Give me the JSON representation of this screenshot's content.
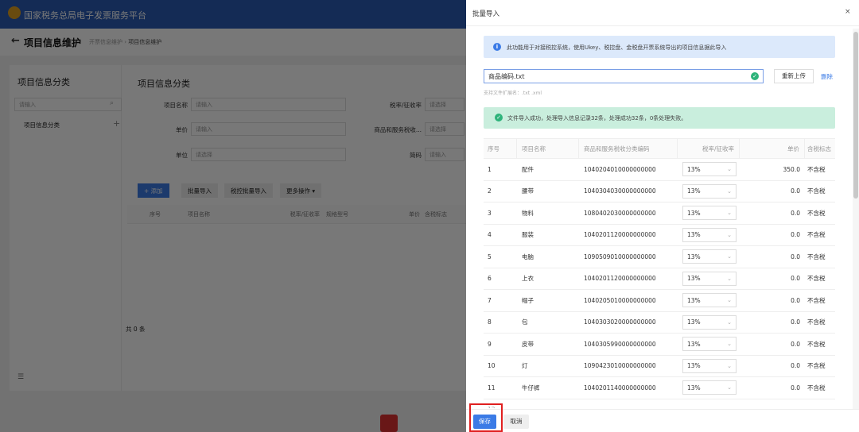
{
  "app": {
    "title": "国家税务总局电子发票服务平台"
  },
  "page": {
    "title": "项目信息维护",
    "breadcrumb": [
      "开票信息维护",
      "项目信息维护"
    ],
    "back_icon": "arrow-left-icon"
  },
  "sidebar": {
    "title": "项目信息分类",
    "search_placeholder": "请输入",
    "tree_item": "项目信息分类"
  },
  "main": {
    "title": "项目信息分类",
    "filters": [
      {
        "label": "项目名称",
        "placeholder": "请输入"
      },
      {
        "label": "税率/征收率",
        "placeholder": "请选择"
      },
      {
        "label": "单价",
        "placeholder": "请输入"
      },
      {
        "label": "商品和服务税收...",
        "placeholder": "请选择"
      },
      {
        "label": "单位",
        "placeholder": "请选择"
      },
      {
        "label": "简码",
        "placeholder": "请输入"
      }
    ],
    "buttons": {
      "add": "+ 添加",
      "batch_import": "批量导入",
      "taxctrl_import": "税控批量导入",
      "more": "更多操作 ▾"
    },
    "columns": [
      "序号",
      "项目名称",
      "税率/征收率",
      "规格型号",
      "单价",
      "含税标志"
    ],
    "total": "共 0 条"
  },
  "drawer": {
    "title": "批量导入",
    "close": "×",
    "info": "此功能用于对接税控系统，使用Ukey、税控盘、金税盘开票系统导出的项目信息据此导入",
    "file_name": "商品编码.txt",
    "reupload": "重新上传",
    "delete": "删除",
    "hint": "支持文件扩展名：.txt .xml",
    "success": "文件导入成功，处理导入信息记录32条，处理成功32条，0条处理失败。",
    "columns": [
      "序号",
      "项目名称",
      "商品和服务税收分类编码",
      "税率/征收率",
      "单价",
      "含税标志"
    ],
    "rows": [
      [
        "1",
        "配件",
        "1040204010000000000",
        "13%",
        "350.0",
        "不含税"
      ],
      [
        "2",
        "腰带",
        "1040304030000000000",
        "13%",
        "0.0",
        "不含税"
      ],
      [
        "3",
        "物料",
        "1080402030000000000",
        "13%",
        "0.0",
        "不含税"
      ],
      [
        "4",
        "服装",
        "1040201120000000000",
        "13%",
        "0.0",
        "不含税"
      ],
      [
        "5",
        "电脑",
        "1090509010000000000",
        "13%",
        "0.0",
        "不含税"
      ],
      [
        "6",
        "上衣",
        "1040201120000000000",
        "13%",
        "0.0",
        "不含税"
      ],
      [
        "7",
        "帽子",
        "1040205010000000000",
        "13%",
        "0.0",
        "不含税"
      ],
      [
        "8",
        "包",
        "1040303020000000000",
        "13%",
        "0.0",
        "不含税"
      ],
      [
        "9",
        "皮带",
        "1040305990000000000",
        "13%",
        "0.0",
        "不含税"
      ],
      [
        "10",
        "灯",
        "1090423010000000000",
        "13%",
        "0.0",
        "不含税"
      ],
      [
        "11",
        "牛仔裤",
        "1040201140000000000",
        "13%",
        "0.0",
        "不含税"
      ]
    ],
    "save": "保存",
    "cancel": "取消"
  },
  "colors": {
    "brand": "#2a5bb5",
    "primary": "#3b7be6",
    "highlight": "#e02020"
  }
}
